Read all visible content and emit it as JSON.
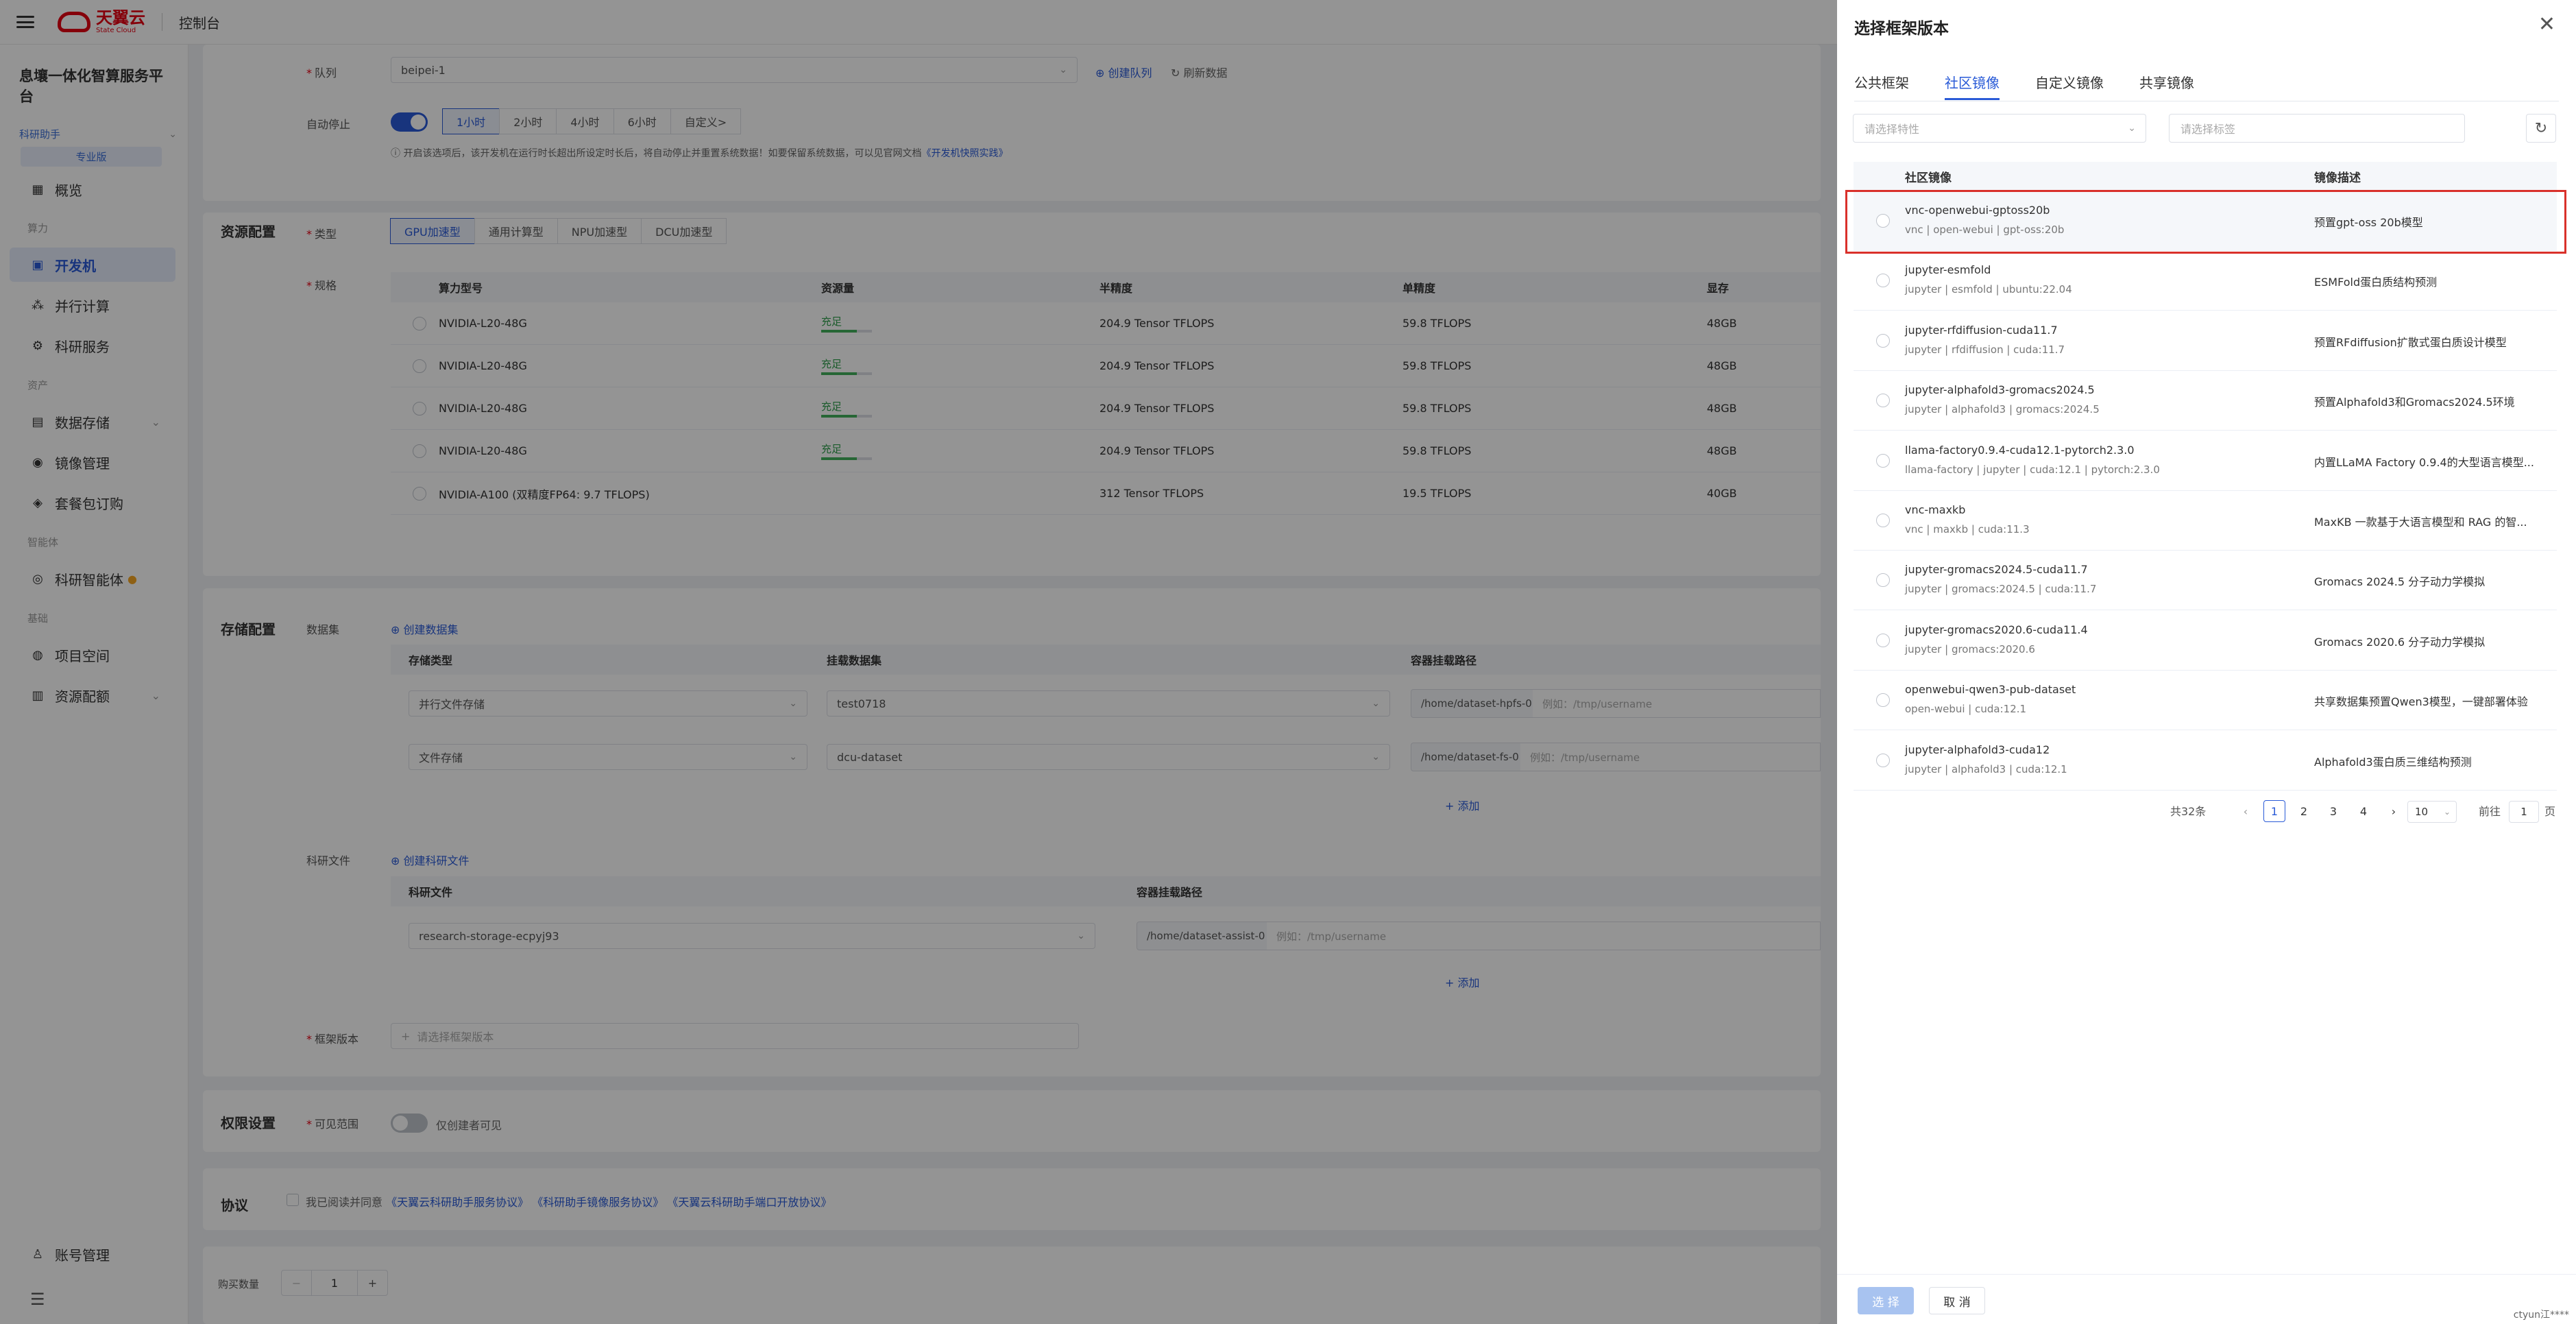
{
  "topbar": {
    "brand_cn": "天翼云",
    "brand_en": "State Cloud",
    "console": "控制台"
  },
  "sidebar": {
    "platform": "息壤一体化智算服务平台",
    "user": "科研助手",
    "badge": "专业版",
    "groups": {
      "compute": "算力",
      "assets": "资产",
      "agent": "智能体",
      "base": "基础"
    },
    "items": {
      "overview": "概览",
      "devbox": "开发机",
      "parallel": "并行计算",
      "research_service": "科研服务",
      "storage": "数据存储",
      "image_mgmt": "镜像管理",
      "package": "套餐包订购",
      "agent": "科研智能体",
      "project": "项目空间",
      "quota": "资源配额",
      "account": "账号管理"
    }
  },
  "form": {
    "queue_label": "队列",
    "queue_value": "beipei-1",
    "create_queue": "创建队列",
    "refresh_data": "刷新数据",
    "autostop_label": "自动停止",
    "autostop_options": [
      "1小时",
      "2小时",
      "4小时",
      "6小时",
      "自定义>"
    ],
    "autostop_tip": "开启该选项后，该开发机在运行时长超出所设定时长后，将自动停止并重置系统数据！如要保留系统数据，可以见官网文档",
    "autostop_doc_link": "《开发机快照实践》",
    "resource_title": "资源配置",
    "type_label": "类型",
    "type_options": [
      "GPU加速型",
      "通用计算型",
      "NPU加速型",
      "DCU加速型"
    ],
    "spec_label": "规格",
    "spec_headers": [
      "算力型号",
      "资源量",
      "半精度",
      "单精度",
      "显存"
    ],
    "spec_rows": [
      {
        "model": "NVIDIA-L20-48G",
        "stock": "充足",
        "half": "204.9 Tensor TFLOPS",
        "single": "59.8 TFLOPS",
        "mem": "48GB"
      },
      {
        "model": "NVIDIA-L20-48G",
        "stock": "充足",
        "half": "204.9 Tensor TFLOPS",
        "single": "59.8 TFLOPS",
        "mem": "48GB"
      },
      {
        "model": "NVIDIA-L20-48G",
        "stock": "充足",
        "half": "204.9 Tensor TFLOPS",
        "single": "59.8 TFLOPS",
        "mem": "48GB"
      },
      {
        "model": "NVIDIA-L20-48G",
        "stock": "充足",
        "half": "204.9 Tensor TFLOPS",
        "single": "59.8 TFLOPS",
        "mem": "48GB"
      },
      {
        "model": "NVIDIA-A100 (双精度FP64: 9.7 TFLOPS)",
        "stock": "",
        "half": "312 Tensor TFLOPS",
        "single": "19.5 TFLOPS",
        "mem": "40GB"
      }
    ],
    "storage_title": "存储配置",
    "dataset_label": "数据集",
    "create_dataset": "创建数据集",
    "ds_headers": [
      "存储类型",
      "挂载数据集",
      "容器挂载路径"
    ],
    "ds_rows": [
      {
        "type": "并行文件存储",
        "dataset": "test0718",
        "path": "/home/dataset-hpfs-0",
        "placeholder": "例如：/tmp/username"
      },
      {
        "type": "文件存储",
        "dataset": "dcu-dataset",
        "path": "/home/dataset-fs-0",
        "placeholder": "例如：/tmp/username"
      }
    ],
    "add": "+ 添加",
    "research_file_label": "科研文件",
    "create_research_file": "创建科研文件",
    "rf_headers": [
      "科研文件",
      "容器挂载路径"
    ],
    "rf_row": {
      "file": "research-storage-ecpyj93",
      "path": "/home/dataset-assist-0",
      "placeholder": "例如：/tmp/username"
    },
    "framework_label": "框架版本",
    "framework_placeholder": "请选择框架版本",
    "perm_title": "权限设置",
    "visible_label": "可见范围",
    "visible_text": "仅创建者可见",
    "protocol_title": "协议",
    "protocol_prefix": "我已阅读并同意",
    "protocol_links": [
      "《天翼云科研助手服务协议》",
      "《科研助手镜像服务协议》",
      "《天翼云科研助手端口开放协议》"
    ],
    "buy_label": "购买数量",
    "buy_value": "1"
  },
  "drawer": {
    "title": "选择框架版本",
    "tabs": [
      "公共框架",
      "社区镜像",
      "自定义镜像",
      "共享镜像"
    ],
    "active_tab": 1,
    "filter_placeholder": "请选择特性",
    "tag_placeholder": "请选择标签",
    "headers": [
      "社区镜像",
      "镜像描述"
    ],
    "rows": [
      {
        "name": "vnc-openwebui-gptoss20b",
        "tags": "vnc | open-webui | gpt-oss:20b",
        "desc": "预置gpt-oss 20b模型"
      },
      {
        "name": "jupyter-esmfold",
        "tags": "jupyter | esmfold | ubuntu:22.04",
        "desc": "ESMFold蛋白质结构预测"
      },
      {
        "name": "jupyter-rfdiffusion-cuda11.7",
        "tags": "jupyter | rfdiffusion | cuda:11.7",
        "desc": "预置RFdiffusion扩散式蛋白质设计模型"
      },
      {
        "name": "jupyter-alphafold3-gromacs2024.5",
        "tags": "jupyter | alphafold3 | gromacs:2024.5",
        "desc": "预置Alphafold3和Gromacs2024.5环境"
      },
      {
        "name": "llama-factory0.9.4-cuda12.1-pytorch2.3.0",
        "tags": "llama-factory | jupyter | cuda:12.1 | pytorch:2.3.0",
        "desc": "内置LLaMA Factory 0.9.4的大型语言模型..."
      },
      {
        "name": "vnc-maxkb",
        "tags": "vnc | maxkb | cuda:11.3",
        "desc": "MaxKB 一款基于大语言模型和 RAG 的智..."
      },
      {
        "name": "jupyter-gromacs2024.5-cuda11.7",
        "tags": "jupyter | gromacs:2024.5 | cuda:11.7",
        "desc": "Gromacs 2024.5 分子动力学模拟"
      },
      {
        "name": "jupyter-gromacs2020.6-cuda11.4",
        "tags": "jupyter | gromacs:2020.6",
        "desc": "Gromacs 2020.6 分子动力学模拟"
      },
      {
        "name": "openwebui-qwen3-pub-dataset",
        "tags": "open-webui | cuda:12.1",
        "desc": "共享数据集预置Qwen3模型，一键部署体验"
      },
      {
        "name": "jupyter-alphafold3-cuda12",
        "tags": "jupyter | alphafold3 | cuda:12.1",
        "desc": "Alphafold3蛋白质三维结构预测"
      }
    ],
    "total": "共32条",
    "pages": [
      "1",
      "2",
      "3",
      "4"
    ],
    "page_size": "10",
    "goto_prefix": "前往",
    "goto_value": "1",
    "goto_suffix": "页",
    "confirm": "选 择",
    "cancel": "取 消",
    "watermark": "ctyun江****"
  }
}
